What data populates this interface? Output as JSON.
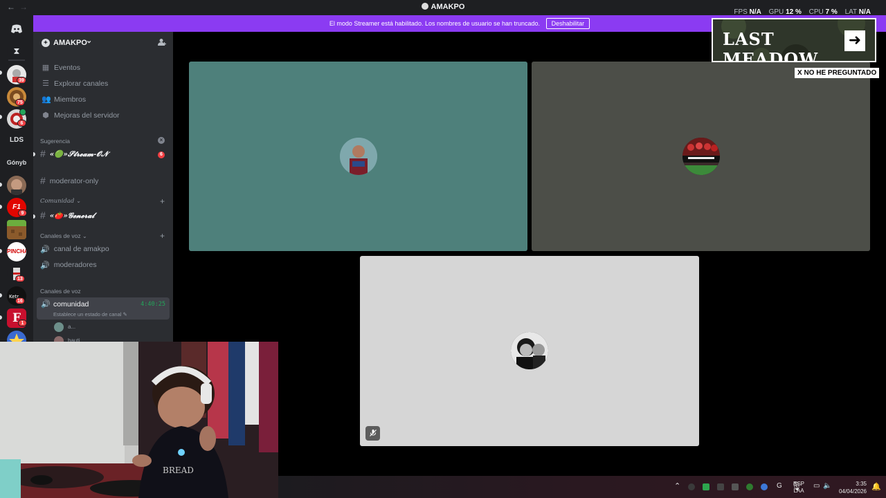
{
  "window": {
    "title": "AMAKPO",
    "back_arrow": "←",
    "forward_arrow": "→"
  },
  "overlay_stats": {
    "fps_label": "FPS",
    "fps_value": "N/A",
    "gpu_label": "GPU",
    "gpu_value": "12 %",
    "cpu_label": "CPU",
    "cpu_value": "7 %",
    "lat_label": "LAT",
    "lat_value": "N/A"
  },
  "banner": {
    "message": "El modo Streamer está habilitado. Los nombres de usuario se han truncado.",
    "button_label": "Deshabilitar",
    "color": "#8b3bf2"
  },
  "rail": {
    "text_servers": [
      "LDS",
      "Gónyb"
    ],
    "badges": [
      "39",
      "75",
      "6",
      "9",
      "13",
      "16",
      "1"
    ]
  },
  "server": {
    "name": "AMAKPO",
    "chevron": "⌄"
  },
  "nav_items": [
    {
      "icon": "calendar-icon",
      "label": "Eventos"
    },
    {
      "icon": "browse-channels-icon",
      "label": "Explorar canales"
    },
    {
      "icon": "members-icon",
      "label": "Miembros"
    },
    {
      "icon": "boost-icon",
      "label": "Mejoras del servidor"
    }
  ],
  "categories": {
    "sugerencia": "Sugerencia",
    "comunidad": "Comunidad",
    "canales_de_voz_1": "Canales de voz",
    "canales_de_voz_2": "Canales de voz"
  },
  "channels": {
    "stream_on": "«🟢»𝓢𝓽𝓻𝓮𝓪𝓶-𝓞𝓝",
    "stream_on_badge": "6",
    "moderator_only": "moderator-only",
    "general": "«🍅»𝓖𝓮𝓷𝓮𝓻𝓪𝓵",
    "canal_de_amakpo": "canal de amakpo",
    "moderadores": "moderadores"
  },
  "voice_channel": {
    "name": "comunidad",
    "timer": "4:40:25",
    "status_placeholder": "Establece un estado de canal",
    "members": [
      "a...",
      "bauti..."
    ]
  },
  "video_tiles": [
    {
      "bg": "#4e807b"
    },
    {
      "bg": "#4c4e48"
    },
    {
      "bg": "#d6d6d6"
    }
  ],
  "overlay_brand": {
    "logo_text": "LAST MEADOW",
    "arrow": "➜",
    "caption": "X NO HE PREGUNTADO"
  },
  "taskbar": {
    "chevron": "⌃",
    "language": "ESP",
    "layout": "LAA",
    "time": "3:35",
    "date": "04/04/2026"
  }
}
